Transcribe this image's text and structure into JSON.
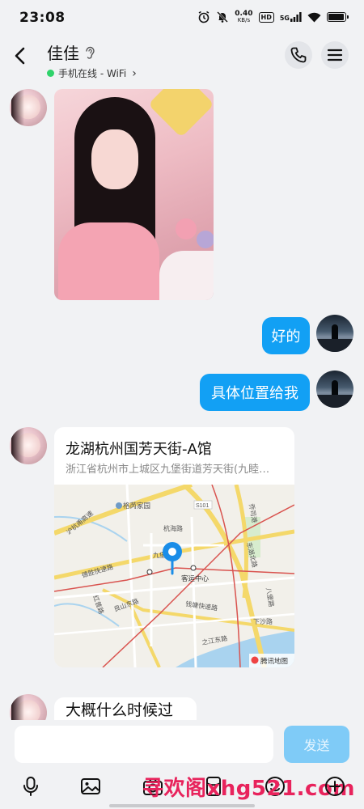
{
  "status_bar": {
    "time": "23:08",
    "net_speed_value": "0.40",
    "net_speed_unit": "KB/s",
    "hd_label": "HD",
    "signal_label": "5G",
    "battery_level_percent": 95
  },
  "header": {
    "contact_name": "佳佳",
    "online_status": "手机在线 - WiFi",
    "status_chevron": "›"
  },
  "messages": [
    {
      "sender": "contact",
      "type": "image"
    },
    {
      "sender": "me",
      "type": "text",
      "text": "好的"
    },
    {
      "sender": "me",
      "type": "text",
      "text": "具体位置给我"
    },
    {
      "sender": "contact",
      "type": "location",
      "title": "龙湖杭州国芳天街-A馆",
      "address": "浙江省杭州市上城区九堡街道芳天街(九睦…"
    },
    {
      "sender": "contact",
      "type": "text",
      "text": "大概什么时候过来"
    }
  ],
  "map_labels": {
    "place1": "格芮家园",
    "road1": "杭海路",
    "road2": "九堡",
    "road3": "德胜快速路",
    "place2": "客运中心",
    "road4": "良山东路",
    "road5": "钱塘快速路",
    "road6": "之江东路",
    "road7": "下沙路",
    "road8": "八堡路",
    "road9": "东湖北路",
    "road10": "乔司港",
    "road11": "红普路",
    "road12": "德胜快速路",
    "road13": "S101",
    "road14": "沪杭甬高速",
    "brand": "腾讯地图"
  },
  "composer": {
    "input_value": "",
    "send_label": "发送"
  },
  "watermark": "寻欢阁xhg521.com",
  "colors": {
    "accent_blue": "#12a0f4",
    "online_green": "#2fd36b",
    "send_disabled": "#7fcbf7"
  }
}
